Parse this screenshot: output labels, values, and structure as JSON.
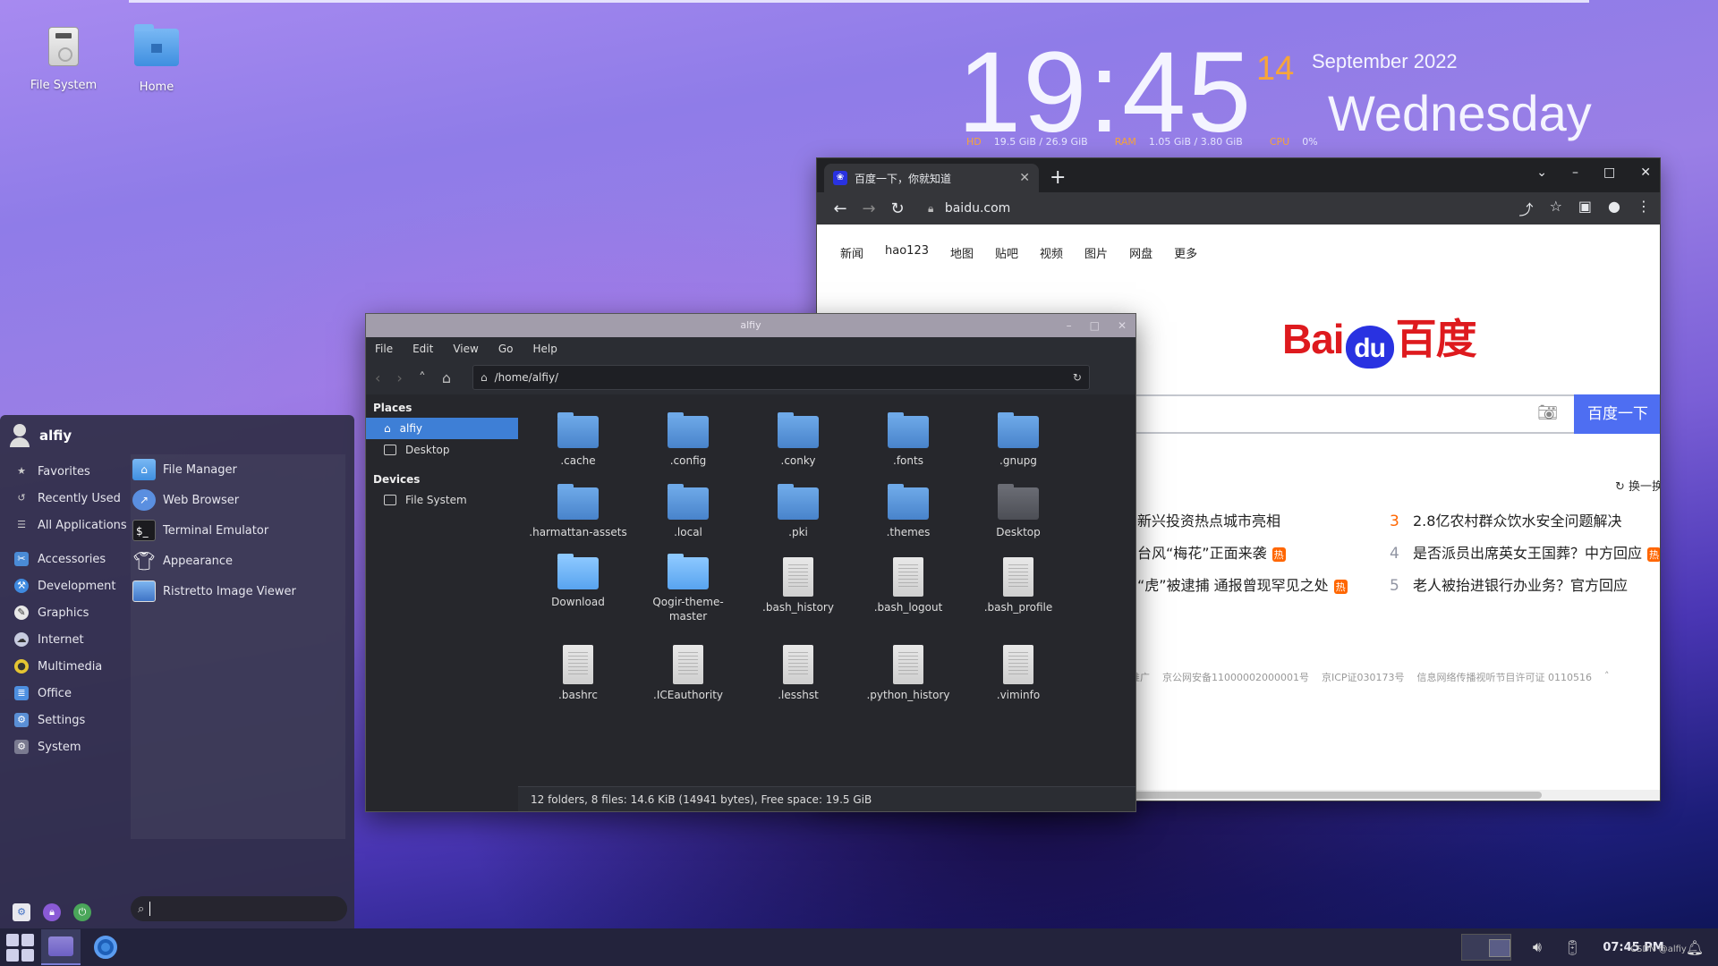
{
  "desktop": {
    "icons": [
      {
        "label": "File System",
        "icon": "drive-icon"
      },
      {
        "label": "Home",
        "icon": "home-folder-icon"
      }
    ]
  },
  "clock": {
    "time": "19:45",
    "day": "14",
    "month_year": "September 2022",
    "weekday": "Wednesday",
    "hd_label": "HD",
    "hd_value": "19.5 GiB / 26.9 GiB",
    "ram_label": "RAM",
    "ram_value": "1.05 GiB / 3.80 GiB",
    "cpu_label": "CPU",
    "cpu_value": "0%"
  },
  "browser": {
    "tab_title": "百度一下，你就知道",
    "url": "baidu.com",
    "top_links": [
      "新闻",
      "hao123",
      "地图",
      "贴吧",
      "视频",
      "图片",
      "网盘",
      "更多"
    ],
    "logo_bai": "Bai",
    "logo_du": "du",
    "logo_cn": "百度",
    "search_button": "百度一下",
    "refresh_label": "换一换",
    "hot_items": [
      {
        "rank": "",
        "text": "新兴投资热点城市亮相",
        "tag": ""
      },
      {
        "rank": "",
        "text": "台风“梅花”正面来袭",
        "tag": "热"
      },
      {
        "rank": "",
        "text": "“虎”被逮捕 通报曾现罕见之处",
        "tag": "热"
      },
      {
        "rank": "3",
        "text": "2.8亿农村群众饮水安全问题解决",
        "tag": ""
      },
      {
        "rank": "4",
        "text": "是否派员出席英女王国葬？中方回应",
        "tag": "热"
      },
      {
        "rank": "5",
        "text": "老人被抬进银行办业务？官方回应",
        "tag": ""
      }
    ],
    "footer_links": [
      "推广",
      "京公网安备11000002000001号",
      "京ICP证030173号",
      "信息网络传播视听节目许可证 0110516"
    ]
  },
  "file_manager": {
    "title": "alfiy",
    "menu": [
      "File",
      "Edit",
      "View",
      "Go",
      "Help"
    ],
    "path": "/home/alfiy/",
    "places_header": "Places",
    "places": [
      "alfiy",
      "Desktop"
    ],
    "devices_header": "Devices",
    "devices": [
      "File System"
    ],
    "items": [
      {
        "name": ".cache",
        "kind": "folder"
      },
      {
        "name": ".config",
        "kind": "folder"
      },
      {
        "name": ".conky",
        "kind": "folder"
      },
      {
        "name": ".fonts",
        "kind": "folder"
      },
      {
        "name": ".gnupg",
        "kind": "folder"
      },
      {
        "name": ".harmattan-assets",
        "kind": "folder"
      },
      {
        "name": ".local",
        "kind": "folder"
      },
      {
        "name": ".pki",
        "kind": "folder"
      },
      {
        "name": ".themes",
        "kind": "folder"
      },
      {
        "name": "Desktop",
        "kind": "desktop"
      },
      {
        "name": "Download",
        "kind": "bright"
      },
      {
        "name": "Qogir-theme-master",
        "kind": "bright"
      },
      {
        "name": ".bash_history",
        "kind": "file"
      },
      {
        "name": ".bash_logout",
        "kind": "file"
      },
      {
        "name": ".bash_profile",
        "kind": "file"
      },
      {
        "name": ".bashrc",
        "kind": "file"
      },
      {
        "name": ".ICEauthority",
        "kind": "file"
      },
      {
        "name": ".lesshst",
        "kind": "file"
      },
      {
        "name": ".python_history",
        "kind": "file"
      },
      {
        "name": ".viminfo",
        "kind": "file"
      }
    ],
    "status": "12 folders, 8 files: 14.6 KiB (14941 bytes), Free space: 19.5 GiB"
  },
  "app_menu": {
    "user": "alfiy",
    "categories_top": [
      "Favorites",
      "Recently Used",
      "All Applications"
    ],
    "categories": [
      "Accessories",
      "Development",
      "Graphics",
      "Internet",
      "Multimedia",
      "Office",
      "Settings",
      "System"
    ],
    "apps": [
      "File Manager",
      "Web Browser",
      "Terminal Emulator",
      "Appearance",
      "Ristretto Image Viewer"
    ],
    "category_colors": [
      "#4a8bd6",
      "#3f8ae0",
      "#e8e8e8",
      "#8aa6d8",
      "#e5c532",
      "#4d8fe0",
      "#5a8fd6",
      "#7a7a90"
    ]
  },
  "taskbar": {
    "clock": "07:45 PM",
    "watermark": "CSDN @alfiy"
  }
}
